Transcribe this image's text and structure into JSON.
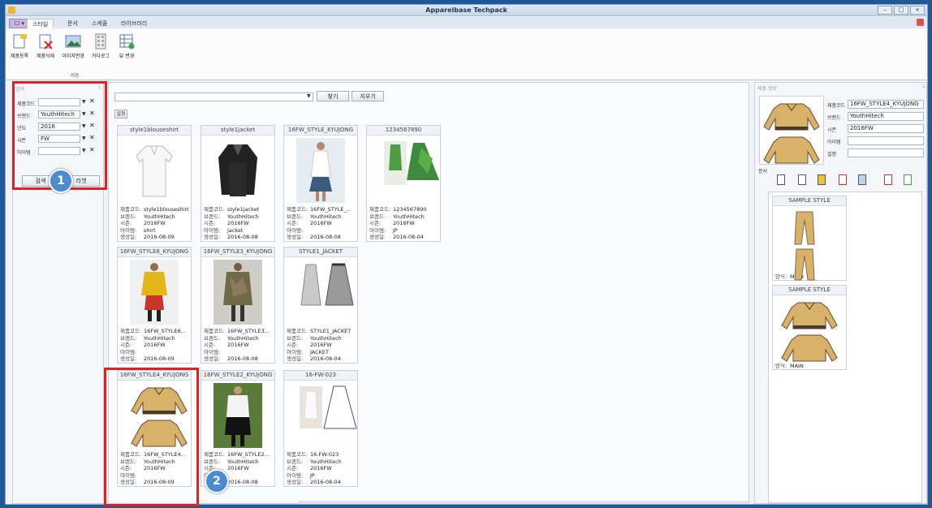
{
  "window": {
    "title": "Apparelbase Techpack",
    "min_label": "–",
    "max_label": "□",
    "close_label": "×"
  },
  "tabs": [
    "스타일",
    "문서",
    "스케줄",
    "라이브러리"
  ],
  "app_button": "☐ ▾",
  "ribbon": {
    "buttons": [
      "제품등록",
      "제품삭제",
      "이미지변경",
      "카다로그",
      "뷰 변경"
    ],
    "group_label": "제품"
  },
  "search_panel": {
    "header": "검색",
    "fields": [
      {
        "label": "제품코드",
        "value": ""
      },
      {
        "label": "브랜드",
        "value": "YouthHitech"
      },
      {
        "label": "년도",
        "value": "2016"
      },
      {
        "label": "시즌",
        "value": "FW"
      },
      {
        "label": "아이템",
        "value": ""
      }
    ],
    "search_button": "검색",
    "reset_button": "리셋"
  },
  "toolbar": {
    "search_value": "",
    "find_button": "찾기",
    "clear_button": "지우기",
    "settings_button": "설정"
  },
  "info_labels": {
    "code": "제품코드:",
    "brand": "브랜드:",
    "season": "시즌:",
    "item": "아이템:",
    "created": "생성일:"
  },
  "products": [
    {
      "title": "style1blouseshirt",
      "code": "style1blouseshirt",
      "brand": "YouthHitech",
      "season": "2016FW",
      "item": "shirt",
      "created": "2016-08-09",
      "image": "blouse"
    },
    {
      "title": "style1jacket",
      "code": "style1jacket",
      "brand": "YouthHitech",
      "season": "2016FW",
      "item": "jacket",
      "created": "2016-08-08",
      "image": "jacket"
    },
    {
      "title": "16FW_STYLE_KYUJONG",
      "code": "16FW_STYLE_...",
      "brand": "YouthHitech",
      "season": "2016FW",
      "item": "",
      "created": "2016-08-08",
      "image": "runway-white"
    },
    {
      "title": "1234567890",
      "code": "1234567890",
      "brand": "YouthHitech",
      "season": "2016FW",
      "item": "JP",
      "created": "2016-08-04",
      "image": "green-dress"
    },
    {
      "title": "16FW_STYLE6_KYUJONG",
      "code": "16FW_STYLE6...",
      "brand": "YouthHitech",
      "season": "2016FW",
      "item": "",
      "created": "2016-08-09",
      "image": "runway-yellow"
    },
    {
      "title": "16FW_STYLE3_KYUJONG",
      "code": "16FW_STYLE3...",
      "brand": "YouthHitech",
      "season": "2016FW",
      "item": "",
      "created": "2016-08-08",
      "image": "runway-camo"
    },
    {
      "title": "STYLE1_JACKET",
      "code": "STYLE1_JACKET",
      "brand": "YouthHitech",
      "season": "2016FW",
      "item": "JACKET",
      "created": "2016-08-04",
      "image": "sketch-dress"
    },
    {
      "title": "16FW_STYLE4_KYUJONG",
      "code": "16FW_STYLE4...",
      "brand": "YouthHitech",
      "season": "2016FW",
      "item": "",
      "created": "2016-08-09",
      "image": "bomber"
    },
    {
      "title": "16FW_STYLE2_KYUJONG",
      "code": "16FW_STYLE2...",
      "brand": "YouthHitech",
      "season": "2016FW",
      "item": "",
      "created": "2016-08-08",
      "image": "runway-black"
    },
    {
      "title": "16-FW-023",
      "code": "16-FW-023",
      "brand": "YouthHitech",
      "season": "2016FW",
      "item": "JP",
      "created": "2016-08-04",
      "image": "sketch-white"
    }
  ],
  "detail": {
    "header": "제품 정보",
    "fields": [
      {
        "label": "제품코드",
        "value": "16FW_STYLE4_KYUJONG"
      },
      {
        "label": "브랜드",
        "value": "YouthHitech"
      },
      {
        "label": "시즌",
        "value": "2016FW"
      },
      {
        "label": "아이템",
        "value": ""
      },
      {
        "label": "설명",
        "value": ""
      }
    ],
    "docs_label": "문서",
    "docs": [
      {
        "title": "SAMPLE STYLE",
        "type_label": "양식:",
        "type_value": "MAIN",
        "image": "pants"
      },
      {
        "title": "SAMPLE STYLE",
        "type_label": "양식:",
        "type_value": "MAIN",
        "image": "bomber"
      }
    ]
  },
  "badges": [
    "1",
    "2"
  ],
  "colors": {
    "accent_red": "#e31e24",
    "badge_blue": "#4b8bcf",
    "bomber": "#d8b26a"
  }
}
